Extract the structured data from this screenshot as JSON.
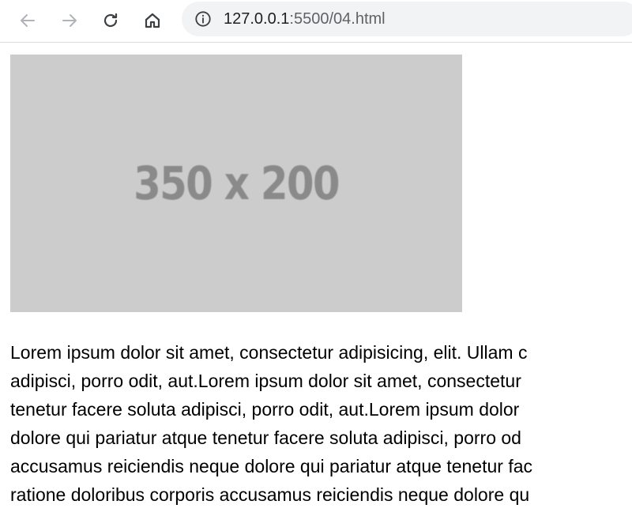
{
  "browser": {
    "url_host": "127.0.0.1",
    "url_rest": ":5500/04.html",
    "icons": {
      "back": "arrow-left",
      "forward": "arrow-right",
      "reload": "circular-arrow",
      "home": "house",
      "site_info": "info-circle"
    }
  },
  "page": {
    "image": {
      "label": "350 x 200",
      "background": "#cccccc",
      "text_color": "#8a8a8a"
    },
    "paragraph_lines": [
      "Lorem ipsum dolor sit amet, consectetur adipisicing, elit. Ullam c",
      "adipisci, porro odit, aut.Lorem ipsum dolor sit amet, consectetur",
      "tenetur facere soluta adipisci, porro odit, aut.Lorem ipsum dolor",
      "dolore qui pariatur atque tenetur facere soluta adipisci, porro od",
      "accusamus reiciendis neque dolore qui pariatur atque tenetur fac",
      "ratione doloribus corporis accusamus reiciendis neque dolore qu"
    ]
  }
}
